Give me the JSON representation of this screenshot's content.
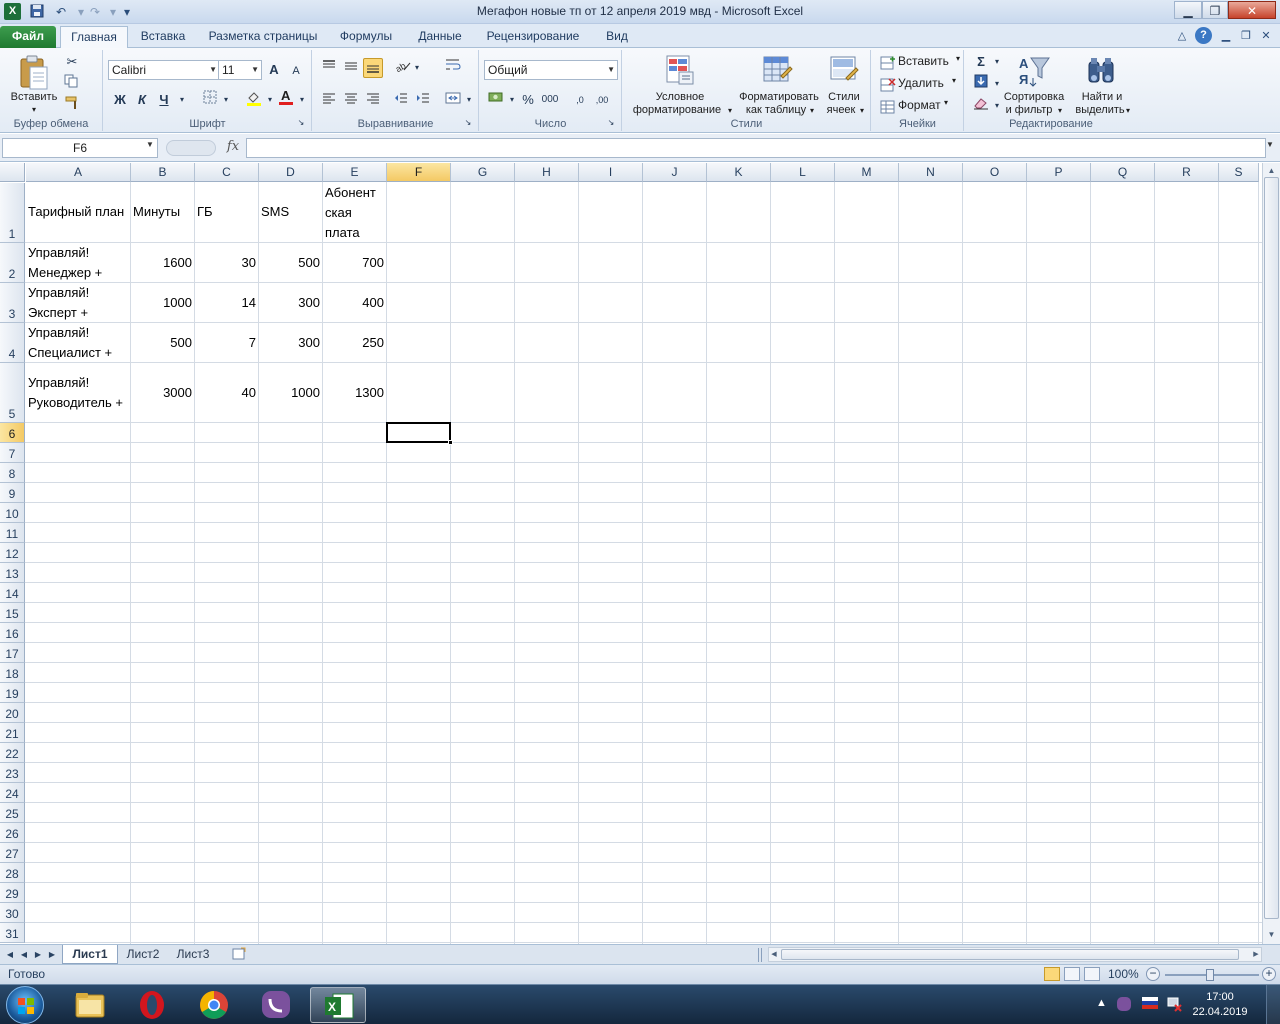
{
  "window": {
    "title": "Мегафон новые тп от 12 апреля 2019 мвд  -  Microsoft Excel",
    "app_icon_letter": "X"
  },
  "ribbon_tabs": [
    "Файл",
    "Главная",
    "Вставка",
    "Разметка страницы",
    "Формулы",
    "Данные",
    "Рецензирование",
    "Вид"
  ],
  "ribbon": {
    "clipboard": {
      "group": "Буфер обмена",
      "paste": "Вставить"
    },
    "font": {
      "group": "Шрифт",
      "name": "Calibri",
      "size": "11",
      "bold": "Ж",
      "italic": "К",
      "underline": "Ч",
      "grow": "A",
      "shrink": "A"
    },
    "alignment": {
      "group": "Выравнивание"
    },
    "number": {
      "group": "Число",
      "format": "Общий",
      "percent": "%",
      "thousands": "000",
      "inc_decimal": ",0",
      "dec_decimal": ",00"
    },
    "styles": {
      "group": "Стили",
      "conditional_1": "Условное",
      "conditional_2": "форматирование",
      "format_table_1": "Форматировать",
      "format_table_2": "как таблицу",
      "cell_styles_1": "Стили",
      "cell_styles_2": "ячеек"
    },
    "cells": {
      "group": "Ячейки",
      "insert": "Вставить",
      "delete": "Удалить",
      "format": "Формат"
    },
    "editing": {
      "group": "Редактирование",
      "sigma": "Σ",
      "sort_1": "Сортировка",
      "sort_2": "и фильтр",
      "find_1": "Найти и",
      "find_2": "выделить"
    }
  },
  "formula_bar": {
    "name_box": "F6",
    "fx": "fx",
    "formula": ""
  },
  "columns": [
    "A",
    "B",
    "C",
    "D",
    "E",
    "F",
    "G",
    "H",
    "I",
    "J",
    "K",
    "L",
    "M",
    "N",
    "O",
    "P",
    "Q",
    "R",
    "S"
  ],
  "rows": [
    "1",
    "2",
    "3",
    "4",
    "5",
    "6",
    "7",
    "8",
    "9",
    "10",
    "11",
    "12",
    "13",
    "14",
    "15",
    "16",
    "17",
    "18",
    "19",
    "20",
    "21",
    "22",
    "23",
    "24",
    "25",
    "26",
    "27",
    "28",
    "29",
    "30",
    "31"
  ],
  "active_cell": "F6",
  "table": {
    "headers": [
      "Тарифный план",
      "Минуты",
      "ГБ",
      "SMS",
      "Абонент\nская\nплата"
    ],
    "rows": [
      [
        "Управляй!\nМенеджер +",
        "1600",
        "30",
        "500",
        "700"
      ],
      [
        "Управляй!\nЭксперт +",
        "1000",
        "14",
        "300",
        "400"
      ],
      [
        "Управляй!\nСпециалист +",
        "500",
        "7",
        "300",
        "250"
      ],
      [
        "Управляй!\nРуководитель +",
        "3000",
        "40",
        "1000",
        "1300"
      ]
    ]
  },
  "sheets": [
    "Лист1",
    "Лист2",
    "Лист3"
  ],
  "status": {
    "ready": "Готово",
    "zoom": "100%",
    "zoom_minus": "−",
    "zoom_plus": "+"
  },
  "taskbar": {
    "time": "17:00",
    "date": "22.04.2019"
  },
  "colors": {
    "accent_green": "#1f7a30",
    "selection": "#f4c964",
    "ribbon_bg": "#dfe9f5"
  }
}
